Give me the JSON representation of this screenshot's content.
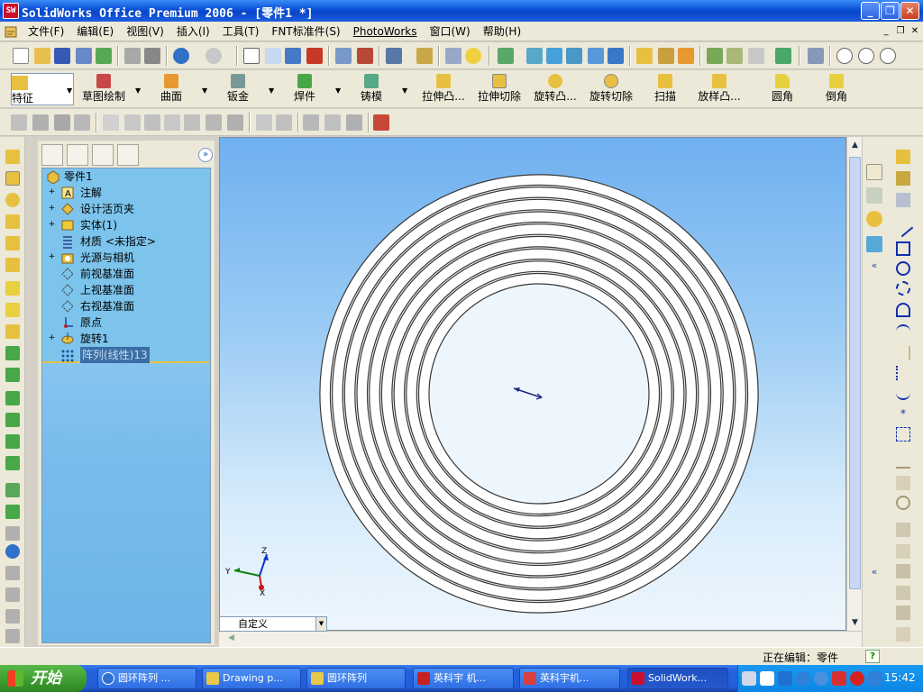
{
  "window": {
    "title": "SolidWorks Office Premium 2006 - [零件1 *]",
    "minimize": "_",
    "restore": "❐",
    "close": "✕"
  },
  "menu": {
    "items": [
      "文件(F)",
      "编辑(E)",
      "视图(V)",
      "插入(I)",
      "工具(T)",
      "FNT标准件(S)",
      "PhotoWorks",
      "窗口(W)",
      "帮助(H)"
    ],
    "mdi_minimize": "_",
    "mdi_restore": "❐",
    "mdi_close": "✕"
  },
  "feature_toolbar": {
    "items": [
      "特征",
      "草图绘制",
      "曲面",
      "钣金",
      "焊件",
      "铸模",
      "拉伸凸...",
      "拉伸切除",
      "旋转凸...",
      "旋转切除",
      "扫描",
      "放样凸...",
      "圆角",
      "倒角"
    ]
  },
  "feature_tree": {
    "collapse": "»",
    "root": "零件1",
    "nodes": [
      {
        "label": "注解",
        "expander": "+",
        "icon": "annotation-icon"
      },
      {
        "label": "设计活页夹",
        "expander": "+",
        "icon": "design-binder-icon"
      },
      {
        "label": "实体(1)",
        "expander": "+",
        "icon": "solid-body-icon"
      },
      {
        "label": "材质 <未指定>",
        "expander": "",
        "icon": "material-icon"
      },
      {
        "label": "光源与相机",
        "expander": "+",
        "icon": "lights-camera-icon"
      },
      {
        "label": "前视基准面",
        "expander": "",
        "icon": "plane-icon"
      },
      {
        "label": "上视基准面",
        "expander": "",
        "icon": "plane-icon"
      },
      {
        "label": "右视基准面",
        "expander": "",
        "icon": "plane-icon"
      },
      {
        "label": "原点",
        "expander": "",
        "icon": "origin-icon"
      },
      {
        "label": "旋转1",
        "expander": "+",
        "icon": "revolve-icon"
      },
      {
        "label": "阵列(线性)13",
        "expander": "",
        "icon": "linear-pattern-icon",
        "selected": true
      }
    ]
  },
  "viewport": {
    "config_value": "自定义",
    "triad": {
      "x": "X",
      "y": "Y",
      "z": "Z"
    },
    "ring_count": 9,
    "colors": {
      "ring": "#ffffff",
      "ring_edge": "#383838"
    }
  },
  "status": {
    "text": "正在编辑：零件",
    "help": "?"
  },
  "taskbar": {
    "start": "开始",
    "tasks": [
      "圆环阵列 ...",
      "Drawing p...",
      "圆环阵列",
      "英科宇 机...",
      "英科宇机...",
      "SolidWork..."
    ],
    "clock": "15:42"
  },
  "taskpane": {
    "collapse": "«"
  }
}
